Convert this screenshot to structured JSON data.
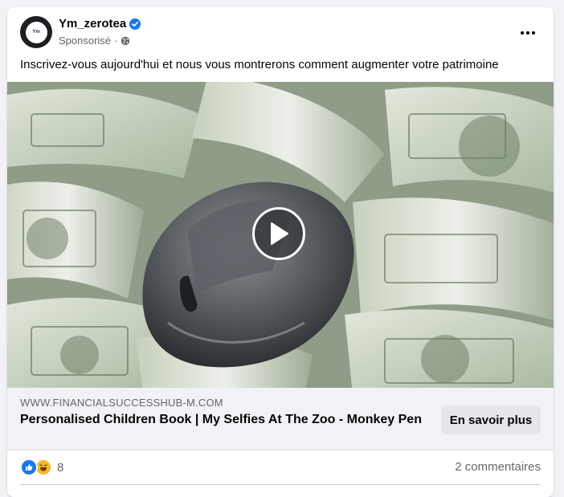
{
  "post": {
    "page_name": "Ym_zerotea",
    "avatar_text": "Ym",
    "sponsored_label": "Sponsorisé",
    "separator": "·",
    "text": "Inscrivez-vous aujourd'hui et nous vous montrerons comment augmenter votre patrimoine"
  },
  "icons": {
    "verified": "verified-badge-icon",
    "audience": "globe-icon",
    "more": "more-horizontal-icon",
    "play": "play-icon",
    "like": "like-reaction-icon",
    "haha": "haha-reaction-icon"
  },
  "link": {
    "domain": "WWW.FINANCIALSUCCESSHUB-M.COM",
    "title": "Personalised Children Book | My Selfies At The Zoo - Monkey Pen",
    "cta_label": "En savoir plus"
  },
  "engagement": {
    "reaction_count": "8",
    "comments_label": "2 commentaires"
  },
  "colors": {
    "accent": "#1877f2",
    "haha": "#f7b928",
    "card_bg": "#ffffff",
    "page_bg": "#f0f2f5",
    "secondary_text": "#65676b"
  }
}
